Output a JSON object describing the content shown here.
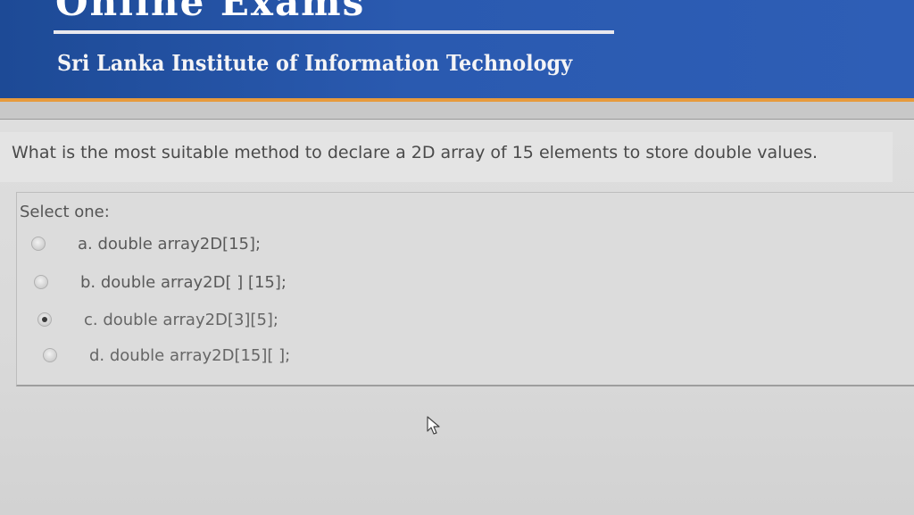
{
  "header": {
    "top_title_partial": "Online Exams",
    "institution": "Sri Lanka Institute of Information Technology"
  },
  "question": {
    "text": "What is the most suitable method to declare a 2D array of 15 elements to store double values.",
    "prompt": "Select one:",
    "options": [
      {
        "label": "a. double array2D[15];",
        "selected": false
      },
      {
        "label": "b. double array2D[ ] [15];",
        "selected": false
      },
      {
        "label": "c. double array2D[3][5];",
        "selected": true
      },
      {
        "label": "d. double array2D[15][ ];",
        "selected": false
      }
    ]
  },
  "colors": {
    "banner": "#2a5ab0",
    "accent": "#e79a3c",
    "background": "#dcdcdc"
  },
  "icons": {
    "cursor": "mouse-pointer-icon",
    "radio": "radio-button"
  }
}
